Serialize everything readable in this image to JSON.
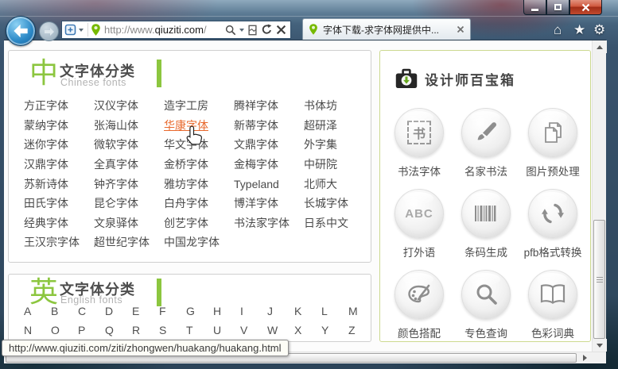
{
  "browser": {
    "tab_title": "字体下载-求字体网提供中...",
    "url_prefix": "http://www.",
    "url_domain": "qiuziti.com",
    "url_suffix": "/",
    "status_url": "http://www.qiuziti.com/ziti/zhongwen/huakang/huakang.html",
    "icons": {
      "home": "⌂",
      "favorites": "★",
      "tools": "⚙"
    }
  },
  "chinese_section": {
    "icon_char": "中",
    "title": "文字体分类",
    "subtitle": "Chinese fonts",
    "links": [
      {
        "label": "方正字体"
      },
      {
        "label": "汉仪字体"
      },
      {
        "label": "造字工房"
      },
      {
        "label": "腾祥字体"
      },
      {
        "label": "书体坊"
      },
      {
        "label": "蒙纳字体"
      },
      {
        "label": "张海山体"
      },
      {
        "label": "华康字体",
        "highlighted": true
      },
      {
        "label": "新蒂字体"
      },
      {
        "label": "超研泽"
      },
      {
        "label": "迷你字体"
      },
      {
        "label": "微软字体"
      },
      {
        "label": "华文字体"
      },
      {
        "label": "文鼎字体"
      },
      {
        "label": "外字集"
      },
      {
        "label": "汉鼎字体"
      },
      {
        "label": "全真字体"
      },
      {
        "label": "金桥字体"
      },
      {
        "label": "金梅字体"
      },
      {
        "label": "中研院"
      },
      {
        "label": "苏新诗体"
      },
      {
        "label": "钟齐字体"
      },
      {
        "label": "雅坊字体"
      },
      {
        "label": "Typeland"
      },
      {
        "label": "北师大"
      },
      {
        "label": "田氏字体"
      },
      {
        "label": "昆仑字体"
      },
      {
        "label": "白舟字体"
      },
      {
        "label": "博洋字体"
      },
      {
        "label": "长城字体"
      },
      {
        "label": "经典字体"
      },
      {
        "label": "文泉驿体"
      },
      {
        "label": "创艺字体"
      },
      {
        "label": "书法家字体"
      },
      {
        "label": "日系中文"
      },
      {
        "label": "王汉宗字体"
      },
      {
        "label": "超世纪字体"
      },
      {
        "label": "中国龙字体"
      }
    ]
  },
  "english_section": {
    "icon_char": "英",
    "title": "文字体分类",
    "subtitle": "English fonts",
    "letters_row1": [
      "A",
      "B",
      "C",
      "D",
      "E",
      "F",
      "G",
      "H",
      "I",
      "J",
      "K",
      "L",
      "M"
    ],
    "letters_row2": [
      "N",
      "O",
      "P",
      "Q",
      "R",
      "S",
      "T",
      "U",
      "V",
      "W",
      "X",
      "Y",
      "Z"
    ]
  },
  "toolbox": {
    "title": "设计师百宝箱",
    "items": [
      {
        "label": "书法字体",
        "icon_char": "书"
      },
      {
        "label": "名家书法"
      },
      {
        "label": "图片预处理"
      },
      {
        "label": "打外语",
        "icon_char": "ABC"
      },
      {
        "label": "条码生成"
      },
      {
        "label": "pfb格式转换"
      },
      {
        "label": "颜色搭配"
      },
      {
        "label": "专色查询"
      },
      {
        "label": "色彩词典"
      }
    ]
  },
  "colors": {
    "accent_green": "#8cc63f",
    "link_highlight": "#e8682c",
    "toolbox_border": "#ccd98f",
    "pin_green": "#76b900"
  }
}
